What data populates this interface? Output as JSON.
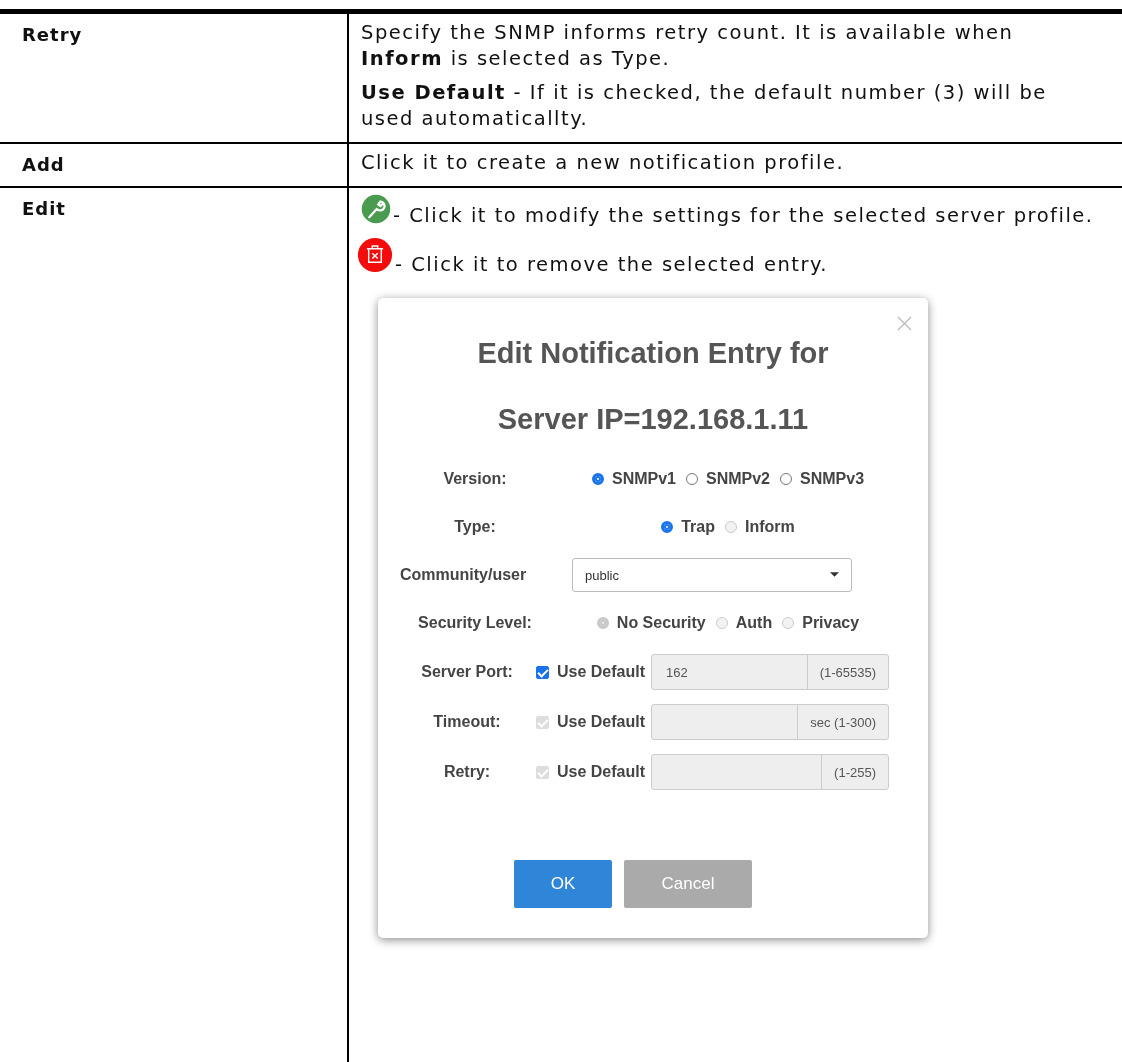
{
  "rows": [
    {
      "label": "Retry",
      "content": [
        {
          "kind": "text",
          "text": "Specify the SNMP informs retry count. It is available when **Inform** is selected as Type."
        },
        {
          "kind": "text",
          "text": "**Use Default** - If it is checked, the default number (3) will be used automaticallty."
        }
      ]
    },
    {
      "label": "Add",
      "content": [
        {
          "kind": "text",
          "text": "Click it to create a new notification profile."
        }
      ]
    },
    {
      "label": "Edit",
      "content": [
        {
          "kind": "edit_icon_text",
          "text": "- Click it to modify the settings for the selected server profile."
        },
        {
          "kind": "delete_icon_text",
          "text": "- Click it to remove the selected entry."
        },
        {
          "kind": "dialog"
        }
      ]
    }
  ],
  "dialog": {
    "title_lines": [
      "Edit Notification Entry for",
      "Server IP=192.168.1.11"
    ],
    "fields": [
      {
        "kind": "radio",
        "label": "Version:",
        "options": [
          {
            "label": "SNMPv1",
            "selected": true,
            "disabled": false
          },
          {
            "label": "SNMPv2",
            "selected": false,
            "disabled": false
          },
          {
            "label": "SNMPv3",
            "selected": false,
            "disabled": false
          }
        ]
      },
      {
        "kind": "radio",
        "label": "Type:",
        "options": [
          {
            "label": "Trap",
            "selected": true,
            "disabled": false
          },
          {
            "label": "Inform",
            "selected": false,
            "disabled": true
          }
        ]
      },
      {
        "kind": "select",
        "label": "Community/user",
        "value": "public"
      },
      {
        "kind": "radio",
        "label": "Security Level:",
        "options": [
          {
            "label": "No Security",
            "selected": true,
            "disabled": true
          },
          {
            "label": "Auth",
            "selected": false,
            "disabled": true
          },
          {
            "label": "Privacy",
            "selected": false,
            "disabled": true
          }
        ]
      },
      {
        "kind": "input",
        "label": "Server Port:",
        "checkbox": {
          "label": "Use Default",
          "checked": true,
          "disabled": false
        },
        "value": "162",
        "addon": "(1-65535)"
      },
      {
        "kind": "input",
        "label": "Timeout:",
        "checkbox": {
          "label": "Use Default",
          "checked": true,
          "disabled": true
        },
        "addon": "sec (1-300)"
      },
      {
        "kind": "input",
        "label": "Retry:",
        "checkbox": {
          "label": "Use Default",
          "checked": true,
          "disabled": true
        },
        "addon": "(1-255)"
      }
    ],
    "buttons": [
      {
        "label": "OK",
        "kind": "primary"
      },
      {
        "label": "Cancel",
        "kind": "secondary"
      }
    ]
  }
}
